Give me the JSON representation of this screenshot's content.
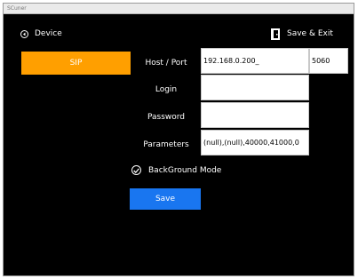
{
  "window": {
    "title": "SCuner"
  },
  "header": {
    "device_label": "Device",
    "device_icon": "back-arrow-circle-icon",
    "save_exit_label": "Save & Exit",
    "save_exit_icon": "door-exit-icon"
  },
  "sidebar": {
    "sip_label": "SIP",
    "sip_color": "#ff9f00"
  },
  "form": {
    "host_port_label": "Host / Port",
    "host_value": "192.168.0.200_",
    "port_value": "5060",
    "login_label": "Login",
    "login_value": "",
    "password_label": "Password",
    "password_value": "",
    "parameters_label": "Parameters",
    "parameters_value": "(null),(null),40000,41000,0",
    "background_mode_label": "BackGround Mode",
    "background_mode_checked": true,
    "save_label": "Save",
    "save_color": "#1976f0"
  }
}
